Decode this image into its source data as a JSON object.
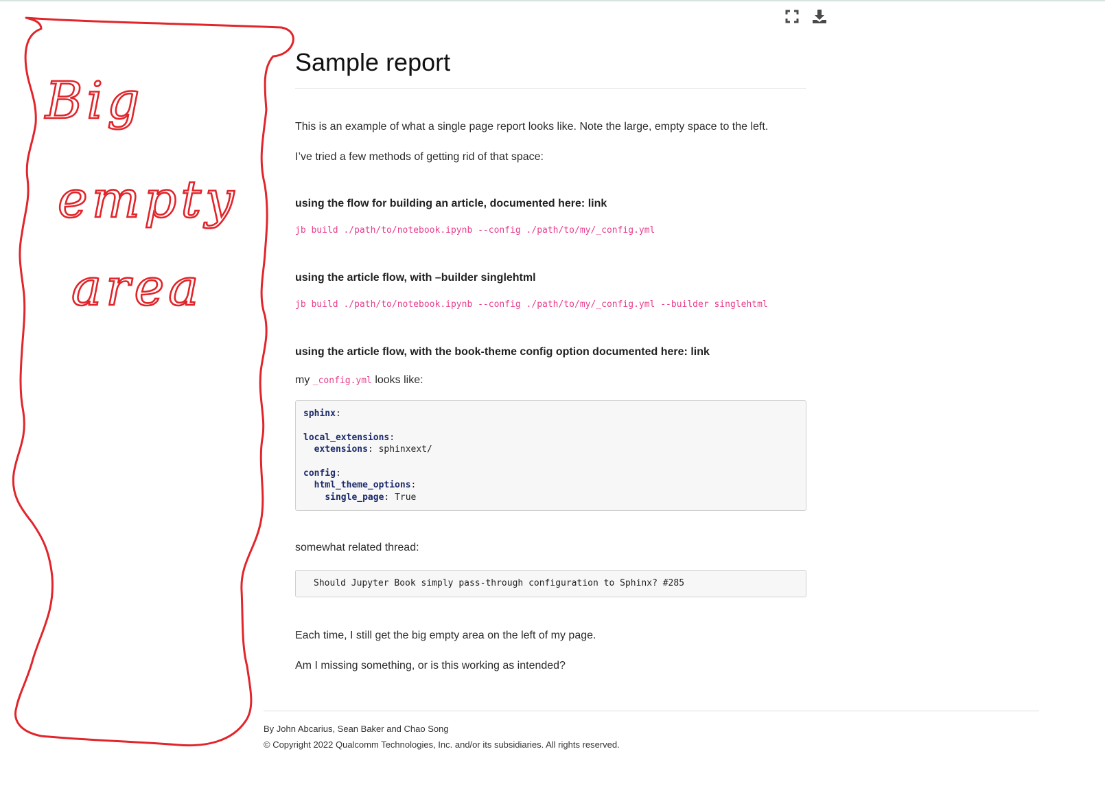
{
  "annotation": {
    "lines": [
      "Big",
      "empty",
      "area"
    ],
    "color": "#e1252a"
  },
  "toolbar": {
    "fullscreen_icon": "fullscreen-icon",
    "download_icon": "download-icon"
  },
  "page": {
    "title": "Sample report",
    "intro": "This is an example of what a single page report looks like. Note the large, empty space to the left.",
    "tried": "I’ve tried a few methods of getting rid of that space:",
    "method1": {
      "heading": "using the flow for building an article, documented here: link",
      "command": "jb build ./path/to/notebook.ipynb --config ./path/to/my/_config.yml"
    },
    "method2": {
      "heading": "using the article flow, with –builder singlehtml",
      "command": "jb build ./path/to/notebook.ipynb --config ./path/to/my/_config.yml --builder singlehtml"
    },
    "method3": {
      "heading": "using the article flow, with the book-theme config option documented here: link"
    },
    "config_line": {
      "prefix": "my",
      "code": "_config.yml",
      "suffix": "looks like:"
    },
    "config_block": {
      "sphinx_key": "sphinx",
      "local_ext_key": "local_extensions",
      "extensions_key": "extensions",
      "extensions_val": "sphinxext/",
      "config_key": "config",
      "html_theme_key": "html_theme_options",
      "single_page_key": "single_page",
      "single_page_val": "True"
    },
    "related_label": "somewhat related thread:",
    "related_thread": "Should Jupyter Book simply pass-through configuration to Sphinx? #285",
    "closing1": "Each time, I still get the big empty area on the left of my page.",
    "closing2": "Am I missing something, or is this working as intended?"
  },
  "footer": {
    "authors": "By John Abcarius, Sean Baker and Chao Song",
    "copyright": "© Copyright 2022 Qualcomm Technologies, Inc. and/or its subsidiaries. All rights reserved."
  }
}
